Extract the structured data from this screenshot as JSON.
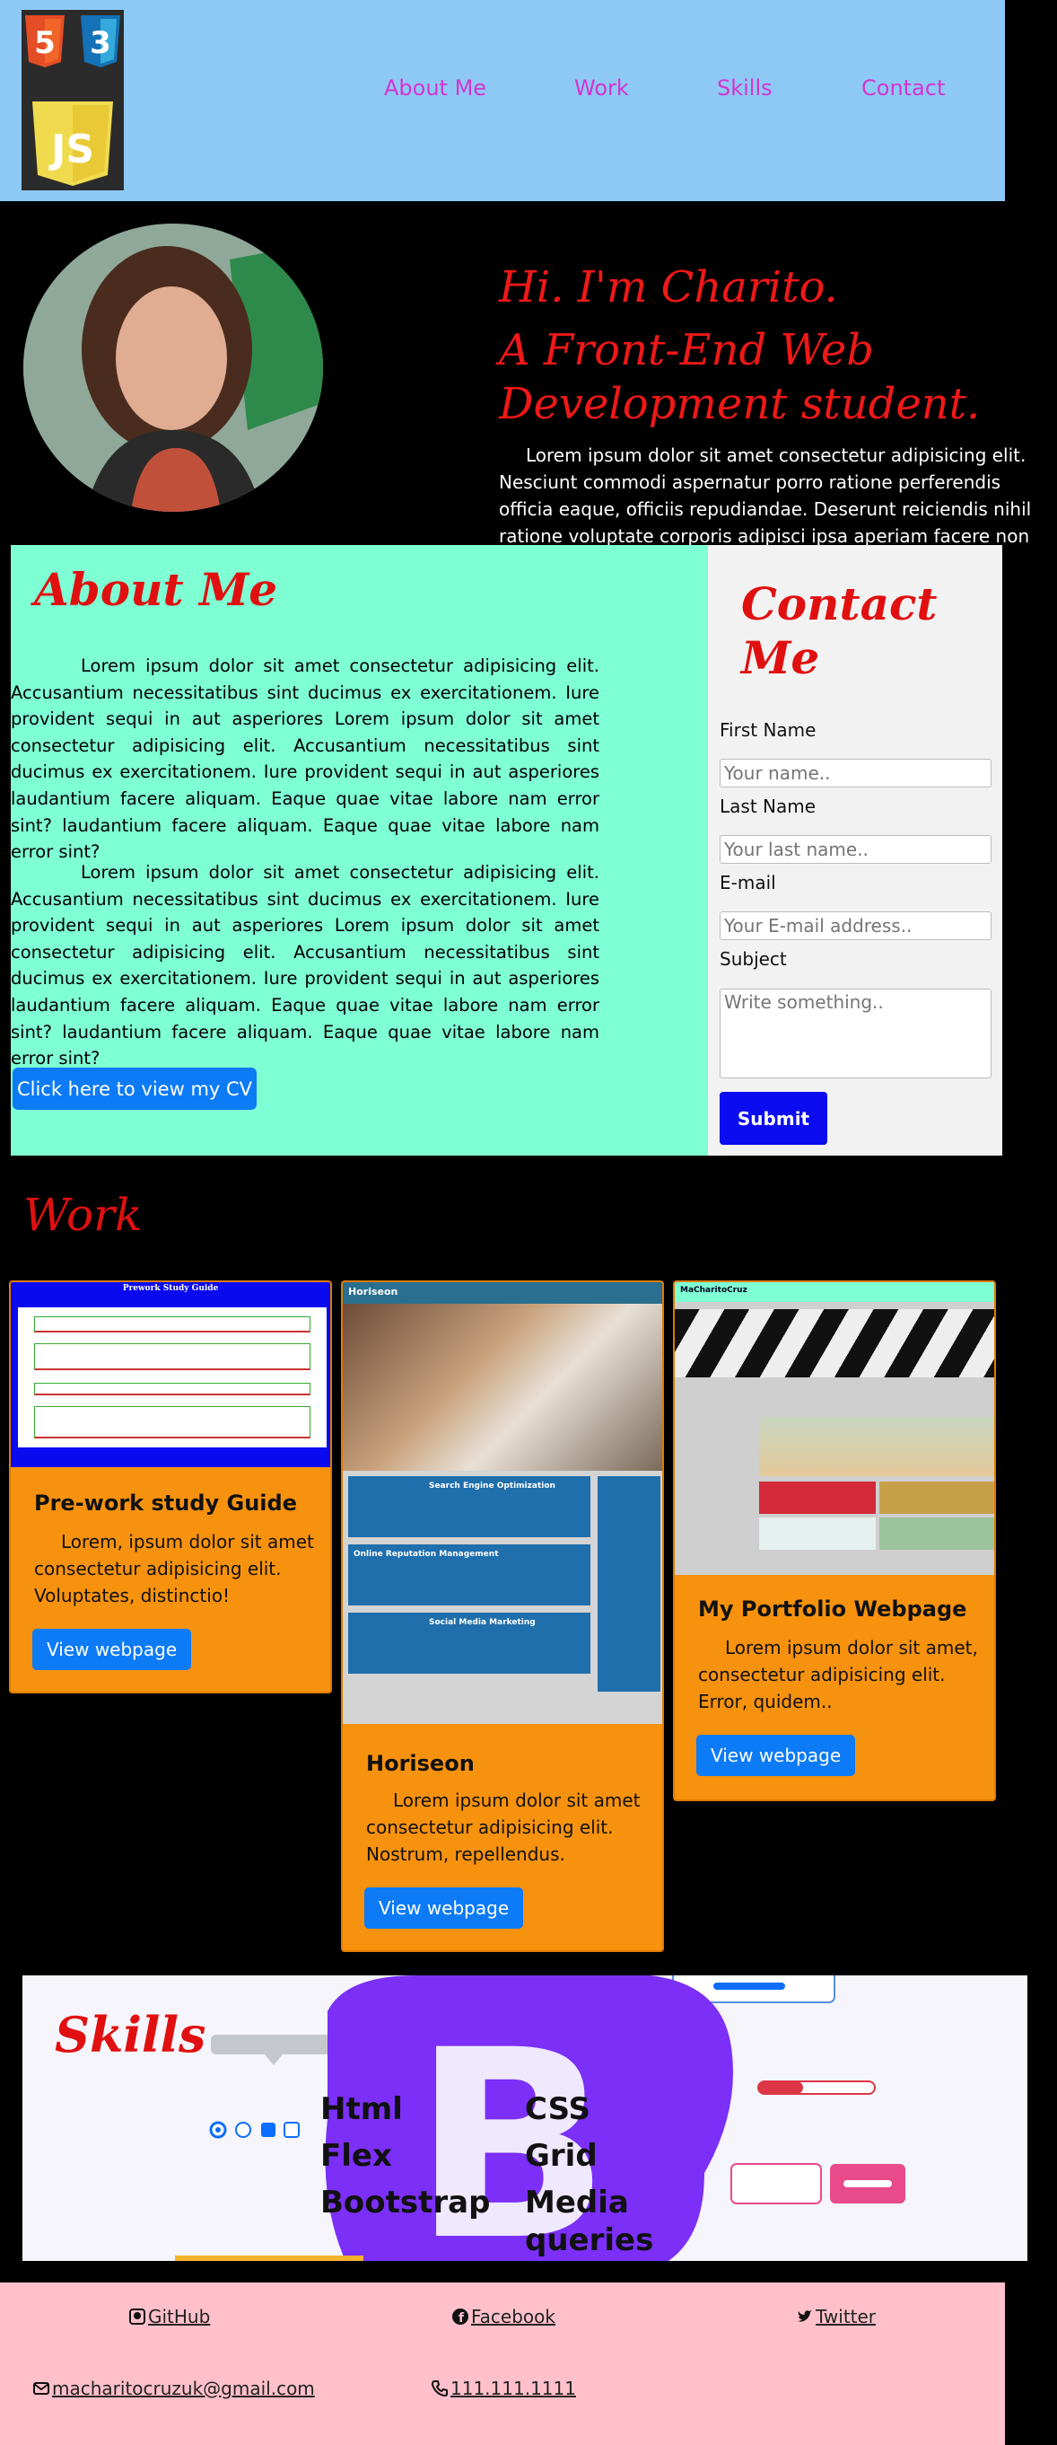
{
  "header": {
    "logo_alt": "HTML CSS JS logo",
    "nav": [
      "About Me",
      "Work",
      "Skills",
      "Contact"
    ]
  },
  "hero": {
    "line1": "Hi. I'm Charito.",
    "line2": "A Front-End Web",
    "line3": "Development student.",
    "text": "Lorem ipsum dolor sit amet consectetur adipisicing elit. Nesciunt commodi aspernatur porro ratione perferendis officia eaque, officiis repudiandae. Deserunt reiciendis nihil ratione voluptate corporis adipisci ipsa aperiam facere non odio."
  },
  "about": {
    "title": "About Me",
    "p1": "Lorem ipsum dolor sit amet consectetur adipisicing elit. Accusantium necessitatibus sint ducimus ex exercitationem. Iure provident sequi in aut asperiores Lorem ipsum dolor sit amet consectetur adipisicing elit. Accusantium necessitatibus sint ducimus ex exercitationem. Iure provident sequi in aut asperiores laudantium facere aliquam. Eaque quae vitae labore nam error sint? laudantium facere aliquam. Eaque quae vitae labore nam error sint?",
    "p2": "Lorem ipsum dolor sit amet consectetur adipisicing elit. Accusantium necessitatibus sint ducimus ex exercitationem. Iure provident sequi in aut asperiores Lorem ipsum dolor sit amet consectetur adipisicing elit. Accusantium necessitatibus sint ducimus ex exercitationem. Iure provident sequi in aut asperiores laudantium facere aliquam. Eaque quae vitae labore nam error sint? laudantium facere aliquam. Eaque quae vitae labore nam error sint?",
    "cv_button": "Click here to view my CV"
  },
  "contact": {
    "title": "Contact Me",
    "first_label": "First Name",
    "first_placeholder": "Your name..",
    "last_label": "Last Name",
    "last_placeholder": "Your last name..",
    "email_label": "E-mail",
    "email_placeholder": "Your E-mail address..",
    "subject_label": "Subject",
    "subject_placeholder": "Write something..",
    "submit": "Submit"
  },
  "work": {
    "title": "Work",
    "cards": [
      {
        "title": "Pre-work study Guide",
        "text": "Lorem, ipsum dolor sit amet consectetur adipisicing elit. Voluptates, distinctio!",
        "button": "View webpage",
        "shot_title": "Prework Study Guide"
      },
      {
        "title": "Horiseon",
        "text": "Lorem ipsum dolor sit amet consectetur adipisicing elit. Nostrum, repellendus.",
        "button": "View webpage",
        "shot_title": "Horiseon",
        "shot_sections": [
          "Search Engine Optimization",
          "Online Reputation Management",
          "Social Media Marketing"
        ]
      },
      {
        "title": "My Portfolio Webpage",
        "text": "Lorem ipsum dolor sit amet, consectetur adipisicing elit. Error, quidem..",
        "button": "View webpage",
        "shot_title": "MaCharitoCruz"
      }
    ]
  },
  "skills": {
    "title": "Skills",
    "items": [
      "Html",
      "CSS",
      "Flex",
      "Grid",
      "Bootstrap",
      "Media queries"
    ]
  },
  "footer": {
    "github": "GitHub",
    "facebook": "Facebook",
    "twitter": "Twitter",
    "email": "macharitocruzuk@gmail.com",
    "phone": "111.111.1111"
  },
  "colors": {
    "header_bg": "#8ec9f5",
    "nav": "#d434d0",
    "accent_red": "#e01010",
    "about_bg": "#7effd4",
    "card_bg": "#f7920e",
    "button_blue": "#0d7bf5",
    "footer_bg": "#ffc0cb"
  }
}
